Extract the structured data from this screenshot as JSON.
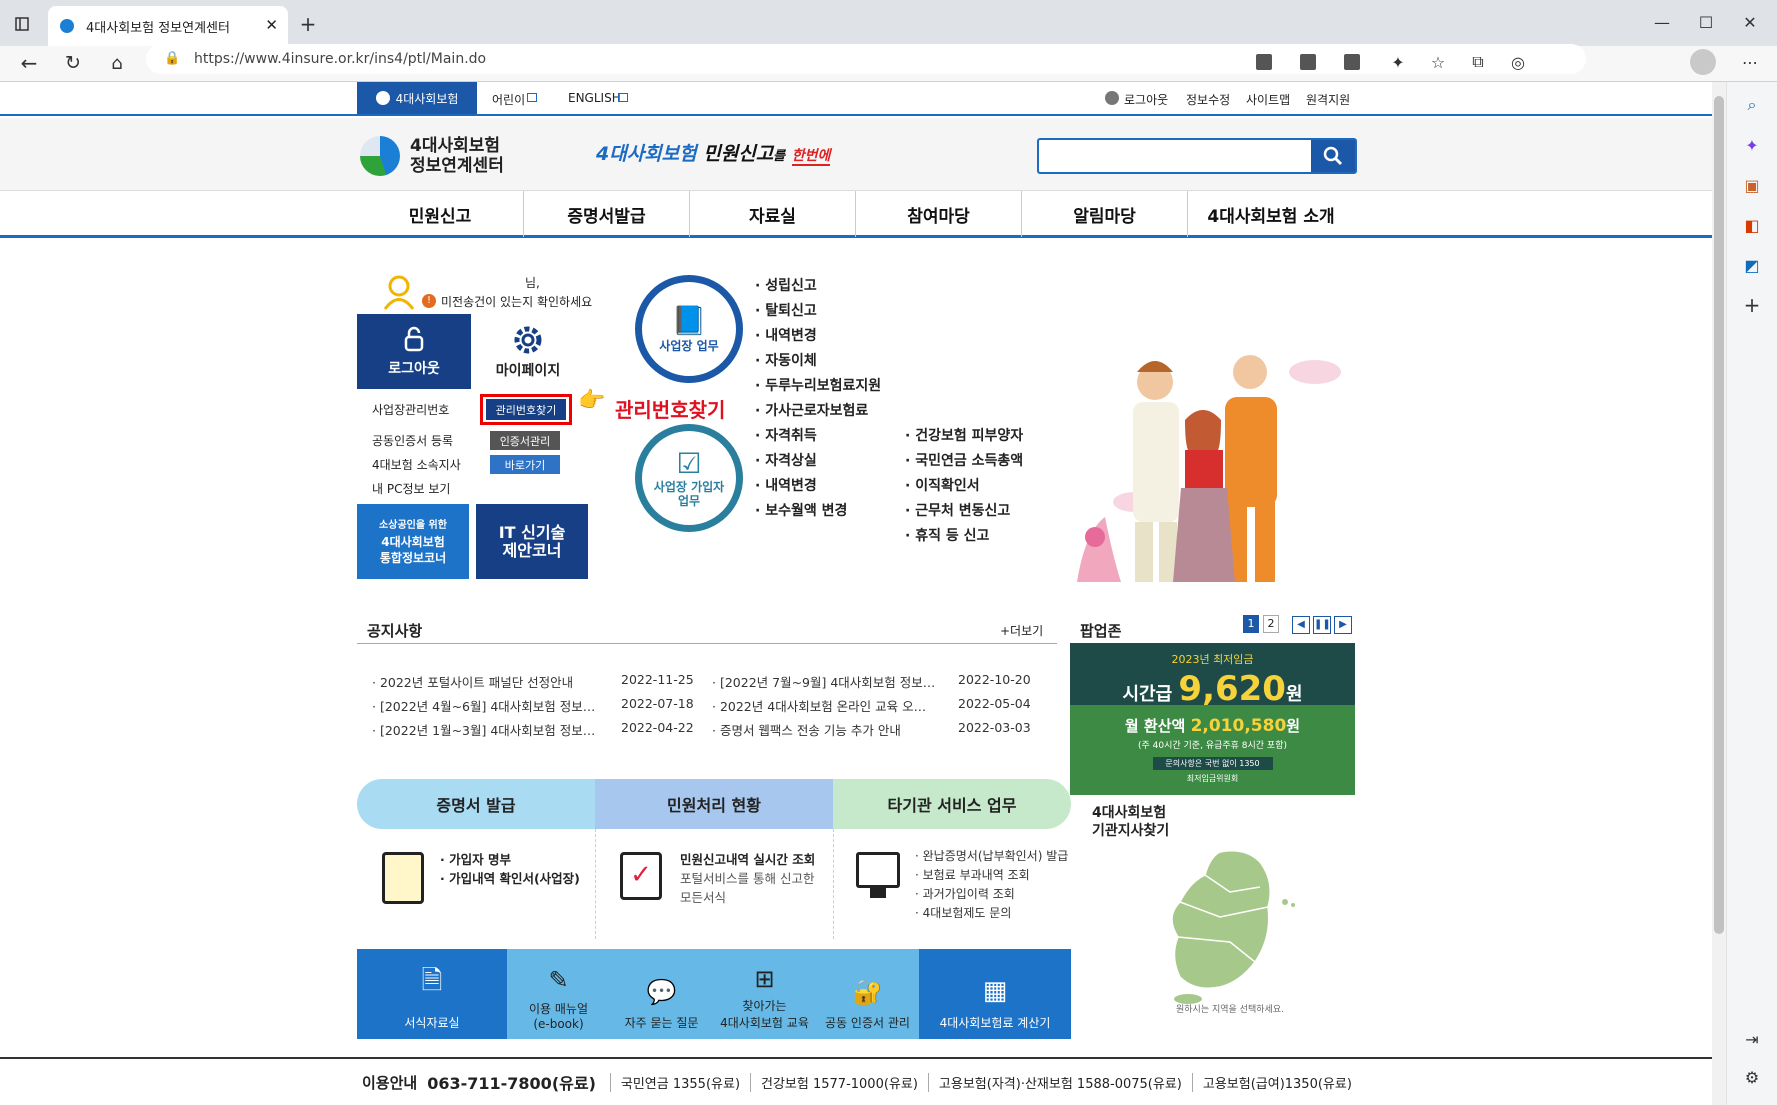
{
  "browser": {
    "tab_title": "4대사회보험 정보연계센터",
    "url": "https://www.4insure.or.kr/ins4/ptl/Main.do"
  },
  "topbar": {
    "brand": "4대사회보험",
    "kids": "어린이",
    "english": "ENGLISH",
    "logout": "로그아웃",
    "edit_info": "정보수정",
    "sitemap": "사이트맵",
    "remote": "원격지원"
  },
  "header": {
    "logo_line1": "4대사회보험",
    "logo_line2": "정보연계센터",
    "slogan_a": "4대사회보험",
    "slogan_b": "민원신고",
    "slogan_c": "를",
    "slogan_d": "한번에",
    "search_placeholder": ""
  },
  "gnb": [
    "민원신고",
    "증명서발급",
    "자료실",
    "참여마당",
    "알림마당",
    "4대사회보험 소개"
  ],
  "user": {
    "suffix": "님,",
    "notice": "미전송건이 있는지 확인하세요",
    "logout": "로그아웃",
    "mypage": "마이페이지"
  },
  "links": [
    {
      "label": "사업장관리번호",
      "btn": "관리번호찾기"
    },
    {
      "label": "공동인증서 등록",
      "btn": "인증서관리"
    },
    {
      "label": "4대보험 소속지사",
      "btn": "바로가기"
    },
    {
      "label": "내 PC정보 보기",
      "btn": ""
    }
  ],
  "callout": "관리번호찾기",
  "banners": {
    "small_l1": "소상공인을 위한",
    "small_l2": "4대사회보험",
    "small_l3": "통합정보코너",
    "it_l1": "IT 신기술",
    "it_l2": "제안코너"
  },
  "biz": {
    "circle1": "사업장 업무",
    "circle2_l1": "사업장 가입자",
    "circle2_l2": "업무",
    "list1": [
      "성립신고",
      "탈퇴신고",
      "내역변경",
      "자동이체",
      "두루누리보험료지원",
      "가사근로자보험료"
    ],
    "list2": [
      "자격취득",
      "자격상실",
      "내역변경",
      "보수월액 변경"
    ],
    "list3": [
      "건강보험 피부양자",
      "국민연금 소득총액",
      "이직확인서",
      "근무처 변동신고",
      "휴직 등 신고"
    ]
  },
  "notice": {
    "title": "공지사항",
    "more": "+더보기",
    "rows": [
      {
        "t": "2022년 포털사이트 패널단 선정안내",
        "d": "2022-11-25"
      },
      {
        "t": "[2022년 7월~9월] 4대사회보험 정보…",
        "d": "2022-10-20"
      },
      {
        "t": "[2022년 4월~6월] 4대사회보험 정보…",
        "d": "2022-07-18"
      },
      {
        "t": "2022년 4대사회보험 온라인 교육 오…",
        "d": "2022-05-04"
      },
      {
        "t": "[2022년 1월~3월] 4대사회보험 정보…",
        "d": "2022-04-22"
      },
      {
        "t": "증명서 웹팩스 전송 기능 추가 안내",
        "d": "2022-03-03"
      }
    ]
  },
  "popup": {
    "title": "팝업존",
    "p1": "1",
    "p2": "2",
    "year": "2023년 최저임금",
    "hour_label": "시간급",
    "hour_val": "9,620",
    "won": "원",
    "month_label": "월 환산액",
    "month_val": "2,010,580",
    "month_won": "원",
    "note": "(주 40시간 기준, 유급주휴 8시간 포함)",
    "contact": "문의사항은 국번 없이 1350",
    "org": "최저임금위원회"
  },
  "services": {
    "tabs": [
      "증명서 발급",
      "민원처리 현황",
      "타기관 서비스 업무"
    ],
    "c1": [
      "가입자 명부",
      "가입내역 확인서(사업장)"
    ],
    "c2_title": "민원신고내역 실시간 조회",
    "c2_l1": "포털서비스를 통해 신고한",
    "c2_l2": "모든서식",
    "c3": [
      "완납증명서(납부확인서) 발급",
      "보험료 부과내역 조회",
      "과거가입이력 조회",
      "4대보험제도 문의"
    ]
  },
  "quick": [
    "서식자료실",
    "이용 매뉴얼",
    "(e-book)",
    "자주 묻는 질문",
    "찾아가는",
    "4대사회보험 교육",
    "공동 인증서 관리",
    "4대사회보험료 계산기"
  ],
  "branch": {
    "t1": "4대사회보험",
    "t2": "기관지사찾기",
    "hint": "원하시는 지역을 선택하세요."
  },
  "footer": {
    "label": "이용안내",
    "main": "063-711-7800(유료)",
    "items": [
      "국민연금 1355(유료)",
      "건강보험 1577-1000(유료)",
      "고용보험(자격)·산재보험 1588-0075(유료)",
      "고용보험(급여)1350(유료)"
    ]
  }
}
